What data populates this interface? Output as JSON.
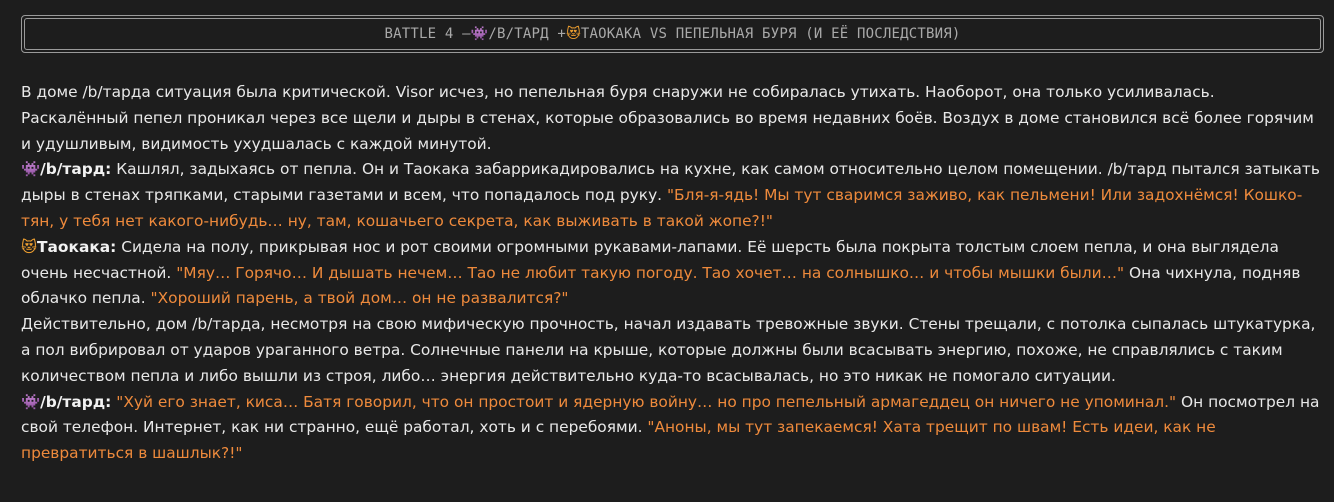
{
  "banner": {
    "prefix": "BATTLE 4 – ",
    "emoji_alien": "👾",
    "part1": "/B/ТАРД + ",
    "emoji_cat": "😻",
    "part2": "ТАОКАКА VS ПЕПЕЛЬНАЯ БУРЯ (И ЕЁ ПОСЛЕДСТВИЯ)"
  },
  "story": {
    "p1": "В доме /b/тарда ситуация была критической. Visor исчез, но пепельная буря снаружи не собиралась утихать. Наоборот, она только усиливалась. Раскалённый пепел проникал через все щели и дыры в стенах, которые образовались во время недавних боёв. Воздух в доме становился всё более горячим и удушливым, видимость ухудшалась с каждой минутой.",
    "p2": {
      "emoji": "👾",
      "speaker": "/b/тард:",
      "text": " Кашлял, задыхаясь от пепла. Он и Таокака забаррикадировались на кухне, как самом относительно целом помещении. /b/тард пытался затыкать дыры в стенах тряпками, старыми газетами и всем, что попадалось под руку. ",
      "quote": "\"Бля-я-ядь! Мы тут сваримся заживо, как пельмени! Или задохнёмся! Кошко-тян, у тебя нет какого-нибудь… ну, там, кошачьего секрета, как выживать в такой жопе?!\""
    },
    "p3": {
      "emoji": "😻",
      "speaker": "Таокака:",
      "text": " Сидела на полу, прикрывая нос и рот своими огромными рукавами-лапами. Её шерсть была покрыта толстым слоем пепла, и она выглядела очень несчастной. ",
      "quote1": "\"Мяу… Горячо… И дышать нечем… Тао не любит такую погоду. Тао хочет… на солнышко… и чтобы мышки были…\"",
      "text2": " Она чихнула, подняв облачко пепла. ",
      "quote2": "\"Хороший парень, а твой дом… он не развалится?\""
    },
    "p4": "Действительно, дом /b/тарда, несмотря на свою мифическую прочность, начал издавать тревожные звуки. Стены трещали, с потолка сыпалась штукатурка, а пол вибрировал от ударов ураганного ветра. Солнечные панели на крыше, которые должны были всасывать энергию, похоже, не справлялись с таким количеством пепла и либо вышли из строя, либо… энергия действительно куда-то всасывалась, но это никак не помогало ситуации.",
    "p5": {
      "emoji": "👾",
      "speaker": "/b/тард:",
      "quote1": "\"Хуй его знает, киса… Батя говорил, что он простоит и ядерную войну… но про пепельный армагеддец он ничего не упоминал.\"",
      "text": " Он посмотрел на свой телефон. Интернет, как ни странно, ещё работал, хоть и с перебоями. ",
      "quote2": "\"Аноны, мы тут запекаемся! Хата трещит по швам! Есть идеи, как не превратиться в шашлык?!\""
    }
  },
  "colors": {
    "background": "#1d1d1d",
    "text": "#e8e8e8",
    "quote": "#ee8a3c",
    "banner_text": "#a9a9a9"
  }
}
